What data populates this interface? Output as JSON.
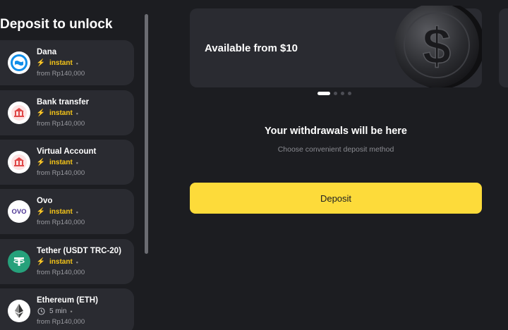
{
  "sidebar": {
    "title": "Deposit to unlock",
    "methods": [
      {
        "name": "Dana",
        "speed": "instant",
        "from": "from Rp140,000",
        "icon": "dana-icon"
      },
      {
        "name": "Bank transfer",
        "speed": "instant",
        "from": "from Rp140,000",
        "icon": "bank-icon"
      },
      {
        "name": "Virtual Account",
        "speed": "instant",
        "from": "from Rp140,000",
        "icon": "bank-icon"
      },
      {
        "name": "Ovo",
        "speed": "instant",
        "from": "from Rp140,000",
        "icon": "ovo-icon",
        "icon_text": "OVO"
      },
      {
        "name": "Tether (USDT TRC-20)",
        "speed": "instant",
        "from": "from Rp140,000",
        "icon": "tether-icon"
      },
      {
        "name": "Ethereum (ETH)",
        "speed": "5 min",
        "from": "from Rp140,000",
        "icon": "ethereum-icon"
      }
    ]
  },
  "banner": {
    "text": "Available from $10",
    "slides": 4,
    "active_slide": 1
  },
  "empty_state": {
    "title": "Your withdrawals will be here",
    "subtitle": "Choose convenient deposit method"
  },
  "deposit_button": {
    "label": "Deposit"
  },
  "colors": {
    "accent": "#fddb3a",
    "speed_instant": "#f5c518",
    "background": "#1c1d21",
    "card": "#2a2b31"
  }
}
